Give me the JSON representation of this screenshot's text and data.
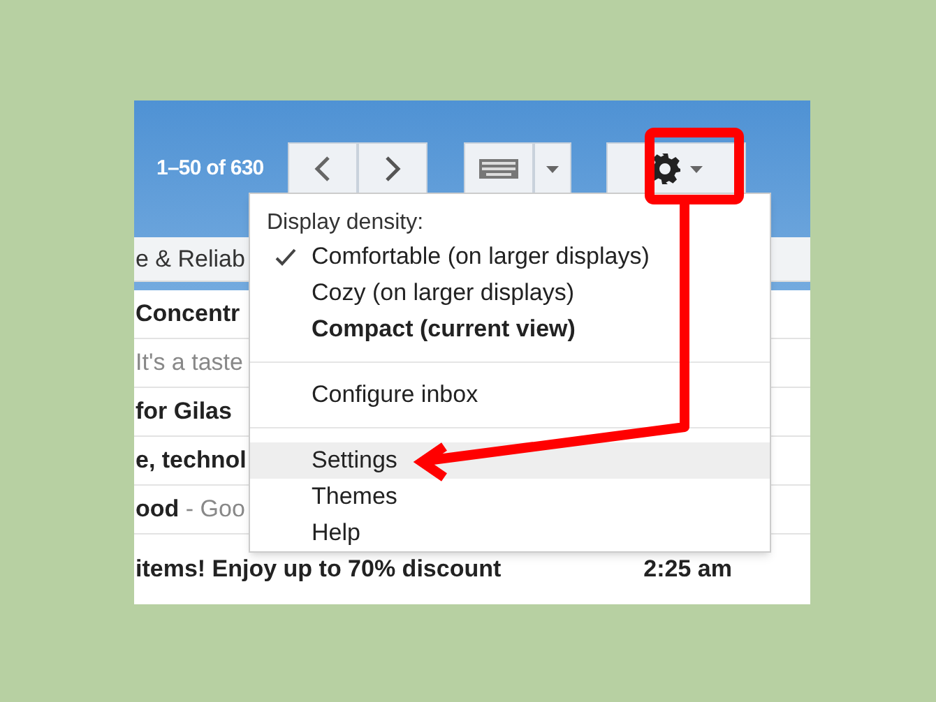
{
  "toolbar": {
    "pager": "1–50 of 630"
  },
  "messages": [
    {
      "kind": "category",
      "text": "e & Reliab",
      "unread": false
    },
    {
      "kind": "message",
      "text": "Concentr",
      "unread": true
    },
    {
      "kind": "message",
      "text": "It's a taste",
      "unread": false
    },
    {
      "kind": "message",
      "text": "for Gilas",
      "unread": true
    },
    {
      "kind": "message",
      "text": "e, technol",
      "unread": true
    },
    {
      "kind": "message",
      "text": "ood",
      "snippet": " - Goo",
      "unread": true
    },
    {
      "kind": "message",
      "text": "items! Enjoy up to 70% discount",
      "time": "2:25 am",
      "unread": true
    }
  ],
  "menu": {
    "heading": "Display density:",
    "density": [
      {
        "label": "Comfortable (on larger displays)",
        "checked": true,
        "current": false
      },
      {
        "label": "Cozy (on larger displays)",
        "checked": false,
        "current": false
      },
      {
        "label": "Compact (current view)",
        "checked": false,
        "current": true
      }
    ],
    "groups": [
      [
        {
          "label": "Configure inbox",
          "highlighted": false
        }
      ],
      [
        {
          "label": "Settings",
          "highlighted": true
        },
        {
          "label": "Themes",
          "highlighted": false
        },
        {
          "label": "Help",
          "highlighted": false
        }
      ]
    ]
  }
}
